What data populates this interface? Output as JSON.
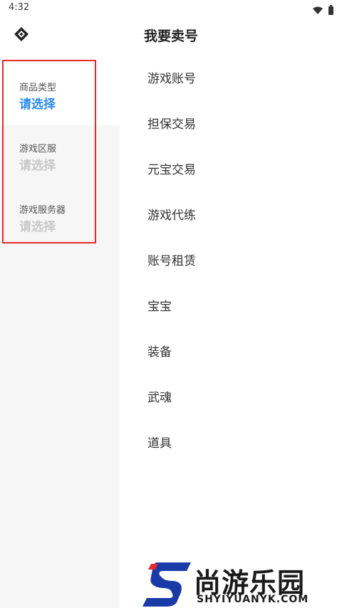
{
  "status_bar": {
    "time": "4:32"
  },
  "header": {
    "title": "我要卖号"
  },
  "filters": [
    {
      "label": "商品类型",
      "value": "请选择",
      "active": true
    },
    {
      "label": "游戏区服",
      "value": "请选择",
      "active": false
    },
    {
      "label": "游戏服务器",
      "value": "请选择",
      "active": false
    }
  ],
  "categories": [
    "游戏账号",
    "担保交易",
    "元宝交易",
    "游戏代练",
    "账号租赁",
    "宝宝",
    "装备",
    "武魂",
    "道具"
  ],
  "watermark": {
    "name": "尚游乐园",
    "url": "SHYIYUANYK.COM"
  },
  "colors": {
    "accent": "#2d8cf0",
    "highlight": "#e8282b",
    "inactive_value": "#c8c8c8"
  }
}
